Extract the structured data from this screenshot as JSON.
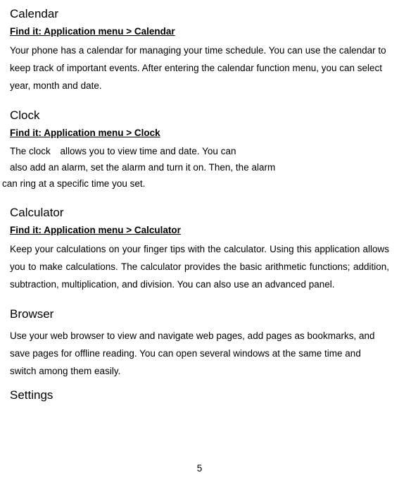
{
  "calendar": {
    "title": "Calendar",
    "find": "Find it: Application menu > Calendar",
    "body": "Your phone has a calendar for managing your time schedule. You can use the calendar to keep track of important events. After entering the calendar function menu, you can select year, month and date."
  },
  "clock": {
    "title": "Clock",
    "find": "Find it: Application menu > Clock",
    "body_lead": "The clock",
    "body_rest": "allows you to view time and date. You can",
    "body_line2": "also add an alarm, set the alarm and turn it on. Then, the alarm",
    "body_line3": "can ring at a specific time you set."
  },
  "calculator": {
    "title": "Calculator",
    "find": "Find it: Application menu > Calculator",
    "body": "Keep your calculations on your finger tips with the calculator. Using this application allows you to make calculations. The calculator provides the basic arithmetic functions; addition, subtraction, multiplication, and division. You can also use an advanced panel."
  },
  "browser": {
    "title": "Browser",
    "body": "Use your web browser to view and navigate web pages, add pages as bookmarks, and save pages for offline reading. You can open several windows at the same time and switch among them easily."
  },
  "settings": {
    "title": "Settings"
  },
  "page_number": "5"
}
